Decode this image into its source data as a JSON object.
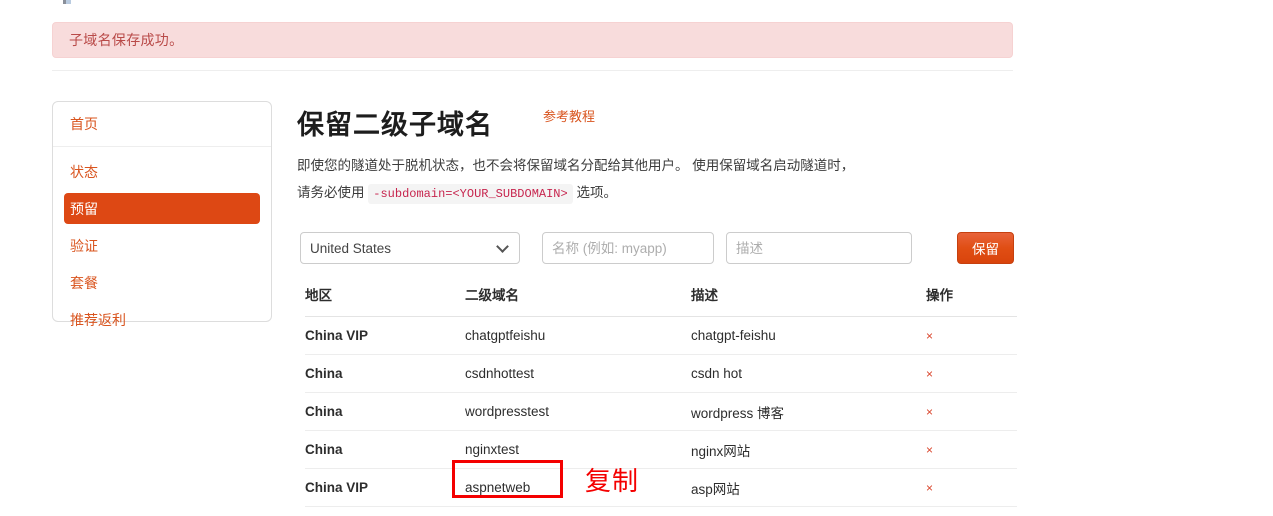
{
  "alert": {
    "message": "子域名保存成功。"
  },
  "sidebar": {
    "header_label": "首页",
    "items": [
      {
        "label": "状态",
        "active": false
      },
      {
        "label": "预留",
        "active": true
      },
      {
        "label": "验证",
        "active": false
      },
      {
        "label": "套餐",
        "active": false
      },
      {
        "label": "推荐返利",
        "active": false
      }
    ]
  },
  "main": {
    "title": "保留二级子域名",
    "tutorial_link": "参考教程",
    "description_part1": "即使您的隧道处于脱机状态，也不会将保留域名分配给其他用户。 使用保留域名启动隧道时，请务必使用 ",
    "description_code": "-subdomain=<YOUR_SUBDOMAIN>",
    "description_part2": " 选项。"
  },
  "form": {
    "region_selected": "United States",
    "region_options": [
      "United States"
    ],
    "name_placeholder": "名称 (例如: myapp)",
    "name_value": "",
    "desc_placeholder": "描述",
    "desc_value": "",
    "submit_label": "保留"
  },
  "table": {
    "headers": {
      "region": "地区",
      "domain": "二级域名",
      "description": "描述",
      "action": "操作"
    },
    "delete_icon": "×",
    "rows": [
      {
        "region": "China VIP",
        "domain": "chatgptfeishu",
        "description": "chatgpt-feishu"
      },
      {
        "region": "China",
        "domain": "csdnhottest",
        "description": "csdn hot"
      },
      {
        "region": "China",
        "domain": "wordpresstest",
        "description": "wordpress 博客"
      },
      {
        "region": "China",
        "domain": "nginxtest",
        "description": "nginx网站"
      },
      {
        "region": "China VIP",
        "domain": "aspnetweb",
        "description": "asp网站"
      }
    ]
  },
  "annotations": {
    "copy_label": "复制"
  },
  "colors": {
    "accent_orange": "#dd4814",
    "alert_bg": "#f8dcdc",
    "alert_text": "#b94a48",
    "annotation_red": "#f40000",
    "code_text": "#c7254e"
  }
}
